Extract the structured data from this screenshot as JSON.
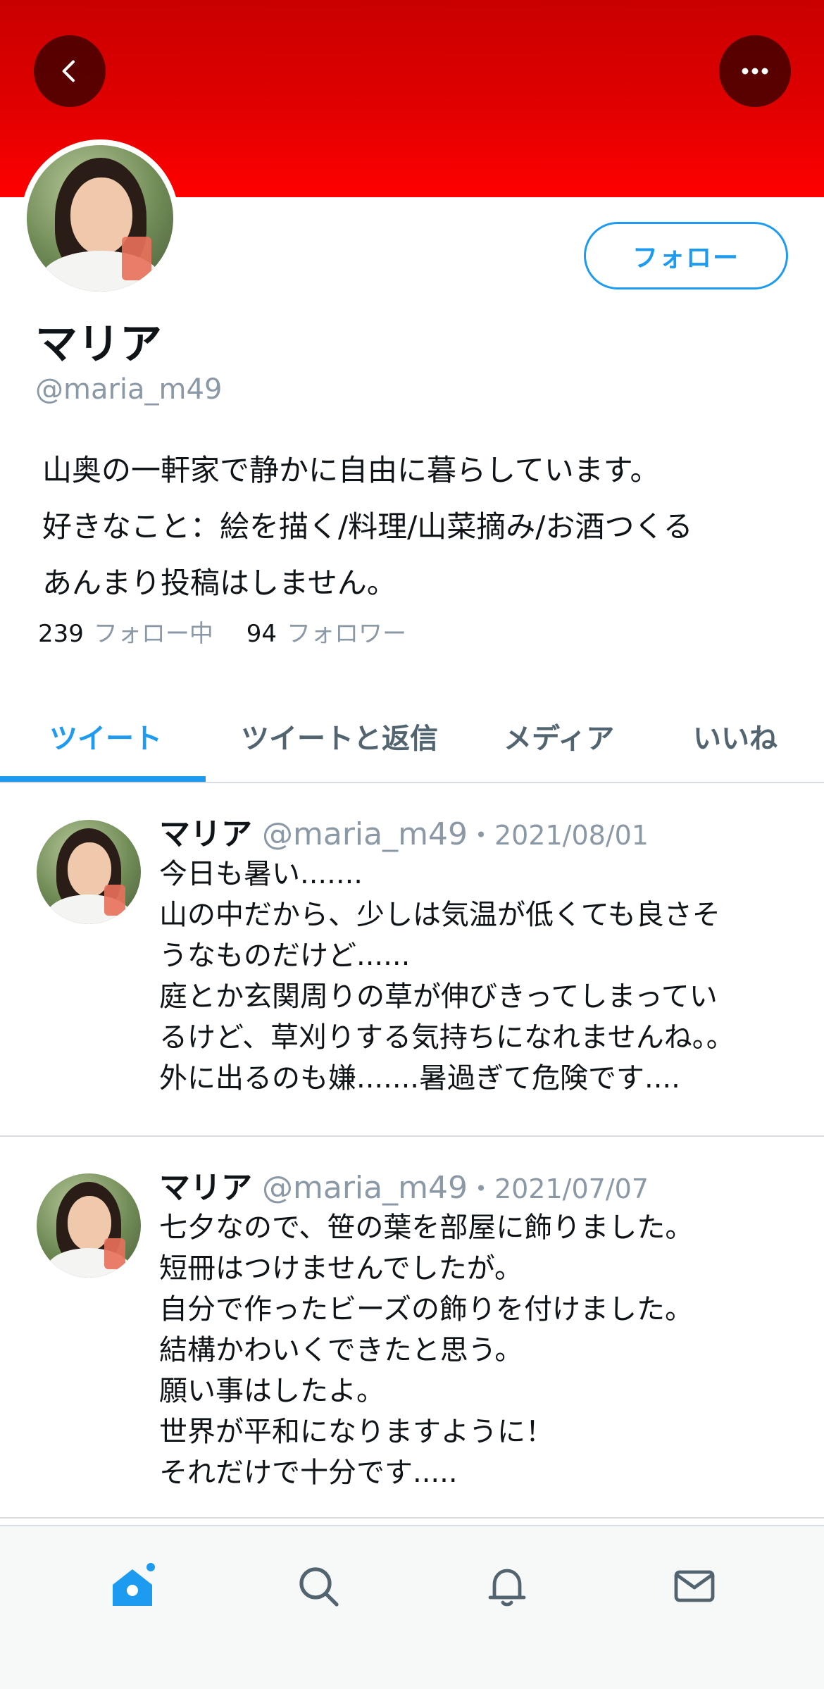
{
  "header": {
    "back_icon": "chevron-left-icon",
    "more_icon": "more-horizontal-icon",
    "banner_color": "#e10000"
  },
  "profile": {
    "name": "マリア",
    "handle": "@maria_m49",
    "follow_label": "フォロー",
    "bio": [
      "山奥の一軒家で静かに自由に暮らしています。",
      "好きなこと：絵を描く/料理/山菜摘み/お酒つくる",
      "あんまり投稿はしません。"
    ],
    "following_count": "239",
    "following_label": "フォロー中",
    "followers_count": "94",
    "followers_label": "フォロワー"
  },
  "tabs": [
    {
      "label": "ツイート",
      "active": true
    },
    {
      "label": "ツイートと返信",
      "active": false
    },
    {
      "label": "メディア",
      "active": false
    },
    {
      "label": "いいね",
      "active": false
    }
  ],
  "tweets": [
    {
      "name": "マリア",
      "handle": "@maria_m49",
      "date": "・2021/08/01",
      "text": "今日も暑い.......\n山の中だから、少しは気温が低くても良さそ\nうなものだけど......\n庭とか玄関周りの草が伸びきってしまってい\nるけど、草刈りする気持ちになれませんね。。\n外に出るのも嫌.......暑過ぎて危険です...."
    },
    {
      "name": "マリア",
      "handle": "@maria_m49",
      "date": "・2021/07/07",
      "text": "七夕なので、笹の葉を部屋に飾りました。\n短冊はつけませんでしたが。\n自分で作ったビーズの飾りを付けました。\n結構かわいくできたと思う。\n願い事はしたよ。\n世界が平和になりますように！\nそれだけで十分です....."
    }
  ],
  "bottom_nav": [
    {
      "icon": "home-icon",
      "active": true
    },
    {
      "icon": "search-icon",
      "active": false
    },
    {
      "icon": "bell-icon",
      "active": false
    },
    {
      "icon": "mail-icon",
      "active": false
    }
  ],
  "colors": {
    "accent": "#1d9bf0",
    "muted": "#8b98a5"
  }
}
